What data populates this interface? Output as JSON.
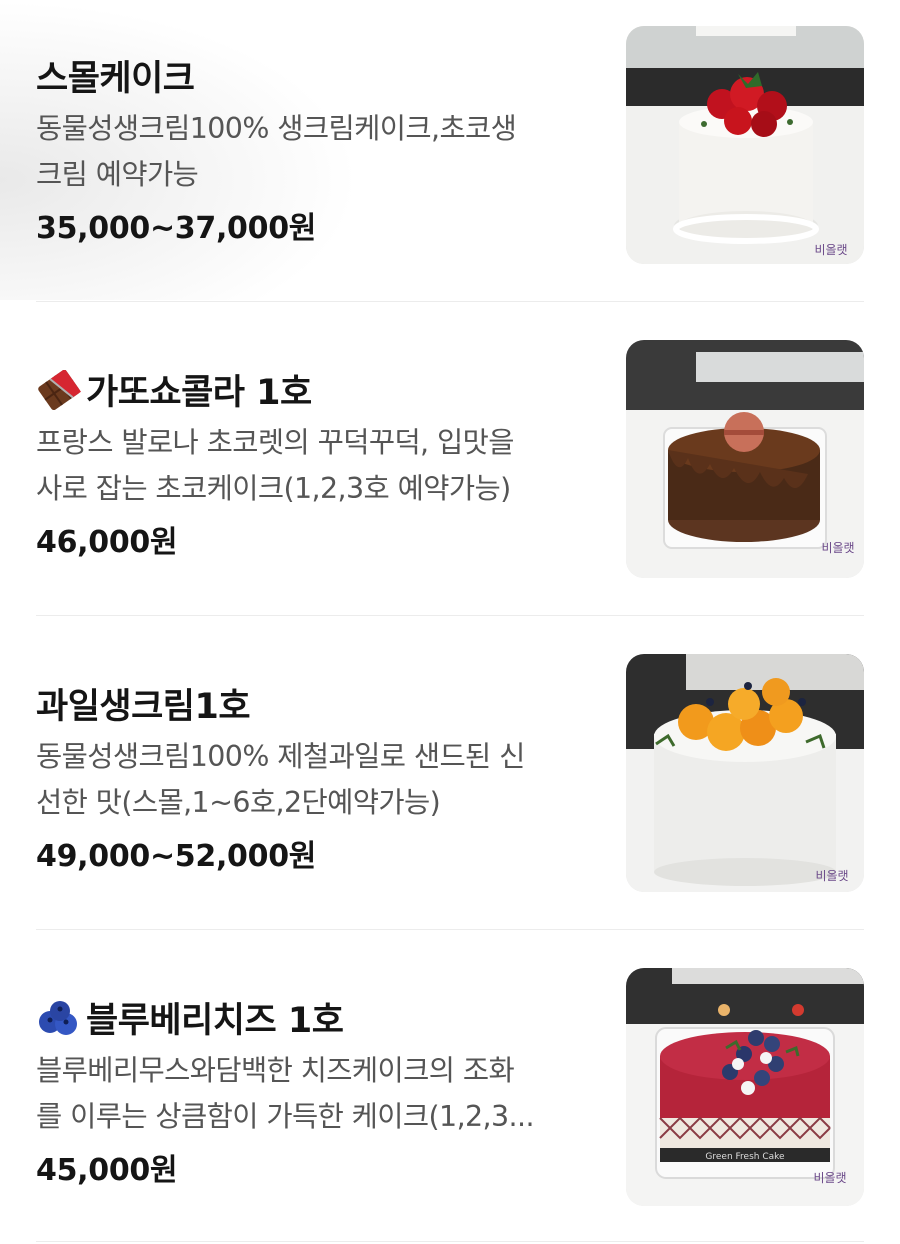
{
  "items": [
    {
      "name": "스몰케이크",
      "icon": "",
      "description_lines": [
        "동물성생크림100% 생크림케이크,초코생",
        "크림 예약가능"
      ],
      "price": "35,000~37,000원",
      "image": "strawberry-cream-cake-photo"
    },
    {
      "name": "가또쇼콜라 1호",
      "icon": "chocolate-bar-emoji",
      "description_lines": [
        "프랑스 발로나 초코렛의 꾸덕꾸덕, 입맛을",
        "사로 잡는 초코케이크(1,2,3호 예약가능)"
      ],
      "price": "46,000원",
      "image": "chocolate-cake-photo"
    },
    {
      "name": "과일생크림1호",
      "icon": "",
      "description_lines": [
        "동물성생크림100% 제철과일로 샌드된 신",
        "선한 맛(스몰,1~6호,2단예약가능)"
      ],
      "price": "49,000~52,000원",
      "image": "fruit-cream-cake-photo"
    },
    {
      "name": "블루베리치즈 1호",
      "icon": "blueberries-emoji",
      "description_lines": [
        "블루베리무스와담백한 치즈케이크의 조화",
        "를 이루는 상큼함이 가득한 케이크(1,2,3..."
      ],
      "price": "45,000원",
      "image": "blueberry-cheesecake-photo"
    }
  ],
  "brand_stamp": "비올랫",
  "box_label": "Green Fresh Cake"
}
